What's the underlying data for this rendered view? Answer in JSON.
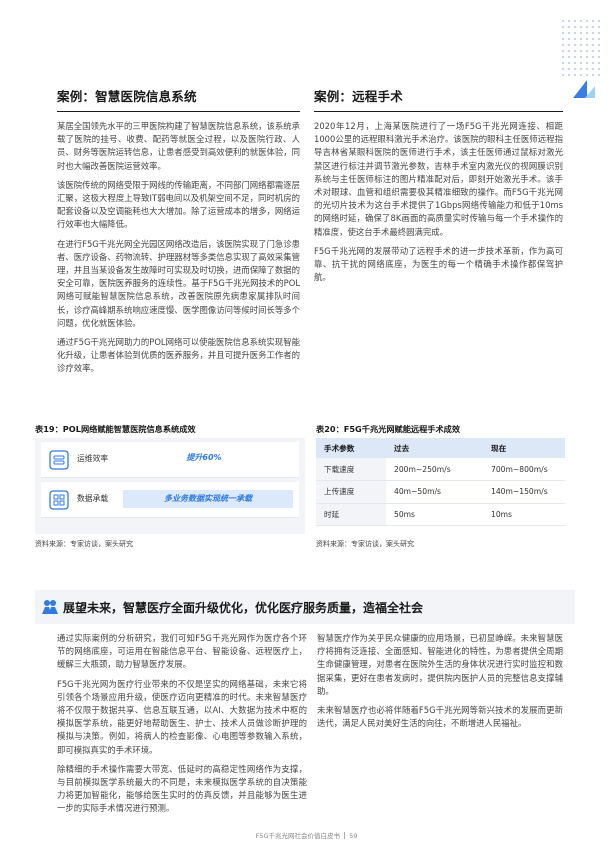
{
  "case_left": {
    "title": "案例：智慧医院信息系统",
    "paragraphs": [
      "某居全国领先水平的三甲医院构建了智慧医院信息系统，该系统承载了医院的挂号、收费、配药等就医全过程，以及医院行政、人员、财务等医院运转信息，让患者感受到高效便利的就医体验，同时也大幅改善医院运营效率。",
      "该医院传统的网络受限于网线的传输距离，不同部门网络都需逐层汇聚，这极大程度上导致IT弱电间以及机架空间不足，同时机房的配套设备以及空调能耗也大大增加。除了运营成本的增多，网络运行效率也大幅降低。",
      "在进行F5G千兆光网全光园区网络改造后，该医院实现了门急诊患者、医疗设备、药物流转、护理器材等多类信息实现了高效采集管理，并且当某设备发生故障时可实现及时切换，进而保障了数据的安全可靠，医院医养服务的连续性。基于F5G千兆光网技术的POL网络可赋能智慧医院信息系统，改善医院原先病患家属排队时间长，诊疗高峰期系统响应速度慢、医学图像访问等候时间长等多个问题，优化就医体验。",
      "通过F5G千兆光网助力的POL网络可以使能医院信息系统实现智能化升级，让患者体验到优质的医养服务，并且可提升医务工作者的诊疗效率。"
    ]
  },
  "case_right": {
    "title": "案例：远程手术",
    "paragraphs": [
      "2020年12月，上海某医院进行了一场F5G千兆光网连接、相距1000公里的远程眼科激光手术治疗。该医院的眼科主任医师远程指导吉林省某眼科医院的医师进行手术，该主任医师通过鼠标对激光禁区进行标注并调节激光参数，吉林手术室内激光仪的视网膜识别系统与主任医师标注的图片精准配对后，即刻开始激光手术。该手术对眼球、血管和组织需要极其精准细致的操作。而F5G千兆光网的光切片技术为这台手术提供了1Gbps网络传输能力和低于10ms的网络时延，确保了8K画面的高质量实时传输与每一个手术操作的精准度，使这台手术最终圆满完成。",
      "F5G千兆光网的发展带动了远程手术的进一步技术革新，作为高可靠、抗干扰的网络底座，为医生的每一个精确手术操作都保驾护航。"
    ]
  },
  "table19": {
    "title": "表19：POL网络赋能智慧医院信息系统成效",
    "rows": [
      {
        "icon": "database-icon",
        "label": "运维效率",
        "value": "提升60%"
      },
      {
        "icon": "grid-icon",
        "label": "数据承载",
        "value": "多业务数据实现统一承载"
      }
    ],
    "source": "资料来源：专家访谈，案头研究"
  },
  "table20": {
    "title": "表20：F5G千兆光网赋能远程手术成效",
    "headers": [
      "手术参数",
      "过去",
      "现在"
    ],
    "rows": [
      [
        "下载速度",
        "200m~250m/s",
        "700m~800m/s"
      ],
      [
        "上传速度",
        "40m~50m/s",
        "140m~150m/s"
      ],
      [
        "时延",
        "50ms",
        "10ms"
      ]
    ],
    "source": "资料来源：专家访谈，案头研究"
  },
  "section": {
    "icon": "people-icon",
    "title": "展望未来，智慧医疗全面升级优化，优化医疗服务质量，造福全社会"
  },
  "bottom_left": [
    "通过实际案例的分析研究，我们可知F5G千兆光网作为医疗各个环节的网络底座，可运用在智能信息平台、智能设备、远程医疗上，缓解三大瓶颈，助力智慧医疗发展。",
    "F5G千兆光网为医疗行业带来的不仅是坚实的网络基础，未来它将引领各个场景应用升级，使医疗迈向更精准的时代。未来智慧医疗将不仅限于数据共享、信息互联互通，以AI、大数据为技术中枢的模拟医学系统，能更好地帮助医生、护士、技术人员做诊断护理的模拟与决策。例如，将病人的检查影像、心电图等参数输入系统，即可模拟真实的手术环境。",
    "除精细的手术操作需要大带宽、低延时的高稳定性网络作为支撑，与目前模拟医学系统最大的不同是，未来模拟医学系统的自决策能力将更加智能化，能够给医生实时的仿真反馈，并且能够为医生进一步的实际手术情况进行预测。"
  ],
  "bottom_right": [
    "智慧医疗作为关乎民众健康的应用场景，已初显峥嵘。未来智慧医疗将拥有泛连接、全面感知、智能进化的特性，为患者提供全周期生命健康管理，对患者在医院外生活的身体状况进行实时监控和数据采集，更好在患者发病时，提供院内医护人员的完整信息支撑辅助。",
    "未来智慧医疗也必将伴随着F5G千兆光网等新兴技术的发展而更新迭代，满足人民对美好生活的向往，不断增进人民福祉。"
  ],
  "footer": {
    "doc_title": "F5G千兆光网社会价值白皮书",
    "page": "59"
  },
  "colors": {
    "accent": "#2f7be0",
    "table_bg": "#f2f4f8",
    "header_bg": "#dce8f8"
  }
}
